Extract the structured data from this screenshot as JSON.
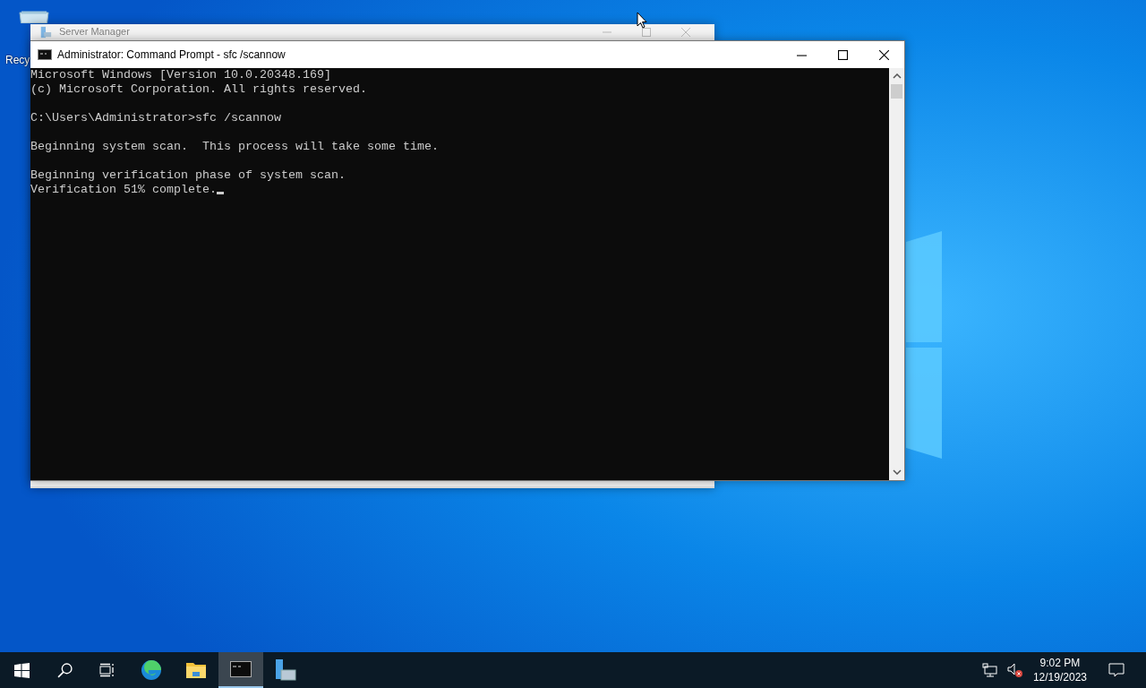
{
  "desktop": {
    "icons": [
      {
        "label": "Recy"
      }
    ]
  },
  "windows": [
    {
      "kind": "background",
      "title": "Server Manager"
    },
    {
      "kind": "console",
      "title": "Administrator: Command Prompt - sfc  /scannow",
      "console": {
        "paragraphs": [
          [
            "Microsoft Windows [Version 10.0.20348.169]",
            "(c) Microsoft Corporation. All rights reserved."
          ],
          [
            "C:\\Users\\Administrator>sfc /scannow"
          ],
          [
            "Beginning system scan.  This process will take some time."
          ],
          [
            "Beginning verification phase of system scan.",
            "Verification 51% complete."
          ]
        ],
        "cursor": true
      }
    }
  ],
  "taskbar": {
    "apps": [
      {
        "kind": "edge",
        "selected": false
      },
      {
        "kind": "explorer",
        "selected": false
      },
      {
        "kind": "cmd",
        "selected": true
      },
      {
        "kind": "server",
        "selected": false
      }
    ],
    "clock": {
      "time": "9:02 PM",
      "date": "12/19/2023"
    }
  }
}
